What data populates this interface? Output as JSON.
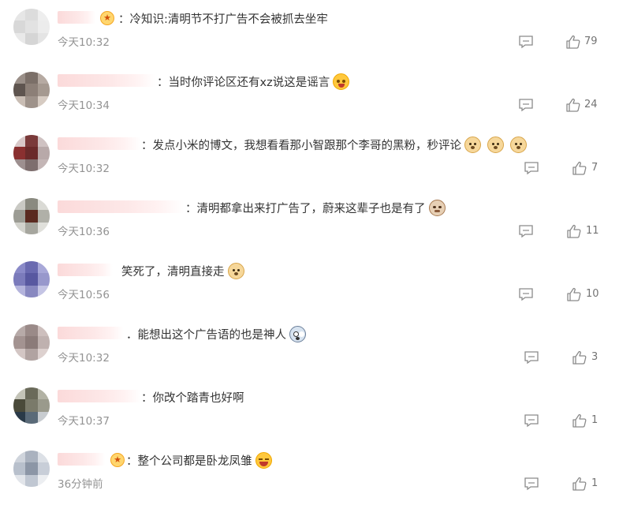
{
  "comments": [
    {
      "text": "冷知识:清明节不打广告不会被抓去坐牢",
      "time": "今天10:32",
      "likes": "79",
      "vip": true,
      "emojis": []
    },
    {
      "text": "当时你评论区还有xz说这是谣言",
      "time": "今天10:34",
      "likes": "24",
      "vip": false,
      "emojis": [
        "cry-face-icon"
      ]
    },
    {
      "text": "发点小米的博文，我想看看那小智跟那个李哥的黑粉，秒评论",
      "time": "今天10:32",
      "likes": "7",
      "vip": false,
      "emojis": [
        "doge-icon",
        "doge-icon",
        "doge-icon"
      ]
    },
    {
      "text": "清明都拿出来打广告了，蔚来这辈子也是有了",
      "time": "今天10:36",
      "likes": "11",
      "vip": false,
      "emojis": [
        "cat-face-icon"
      ]
    },
    {
      "text": "笑死了，清明直接走",
      "time": "今天10:56",
      "likes": "10",
      "vip": false,
      "emojis": [
        "doge-icon"
      ]
    },
    {
      "text": "能想出这个广告语的也是神人",
      "time": "今天10:32",
      "likes": "3",
      "vip": false,
      "emojis": [
        "scared-face-icon"
      ]
    },
    {
      "text": "你改个踏青也好啊",
      "time": "今天10:37",
      "likes": "1",
      "vip": false,
      "emojis": []
    },
    {
      "text": "整个公司都是卧龙凤雏",
      "time": "36分钟前",
      "likes": "1",
      "vip": true,
      "emojis": [
        "laugh-icon"
      ]
    }
  ],
  "separator_colon": "："
}
